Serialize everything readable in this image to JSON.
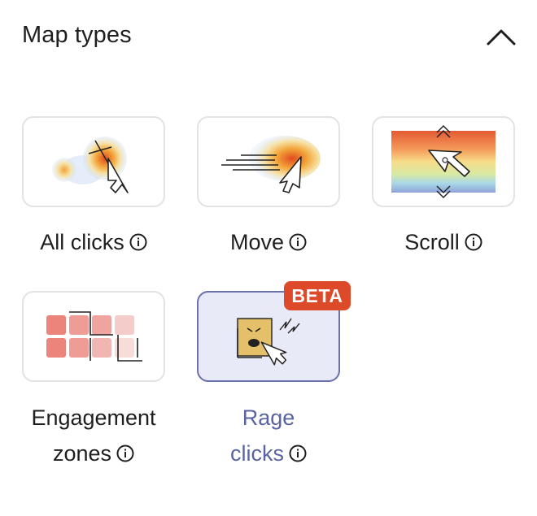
{
  "header": {
    "title": "Map types"
  },
  "map_types": [
    {
      "label": "All clicks",
      "icon": "all-clicks-heatmap-icon"
    },
    {
      "label": "Move",
      "icon": "move-heatmap-icon"
    },
    {
      "label": "Scroll",
      "icon": "scroll-heatmap-icon"
    },
    {
      "label_line1": "Engagement",
      "label_line2": "zones",
      "icon": "engagement-zones-icon"
    },
    {
      "label_line1": "Rage",
      "label_line2": "clicks",
      "icon": "rage-clicks-icon",
      "badge": "BETA",
      "selected": true
    }
  ],
  "colors": {
    "accent": "#5a63a4",
    "badge": "#dd4a2a",
    "selected_bg": "#e9eaf7"
  }
}
